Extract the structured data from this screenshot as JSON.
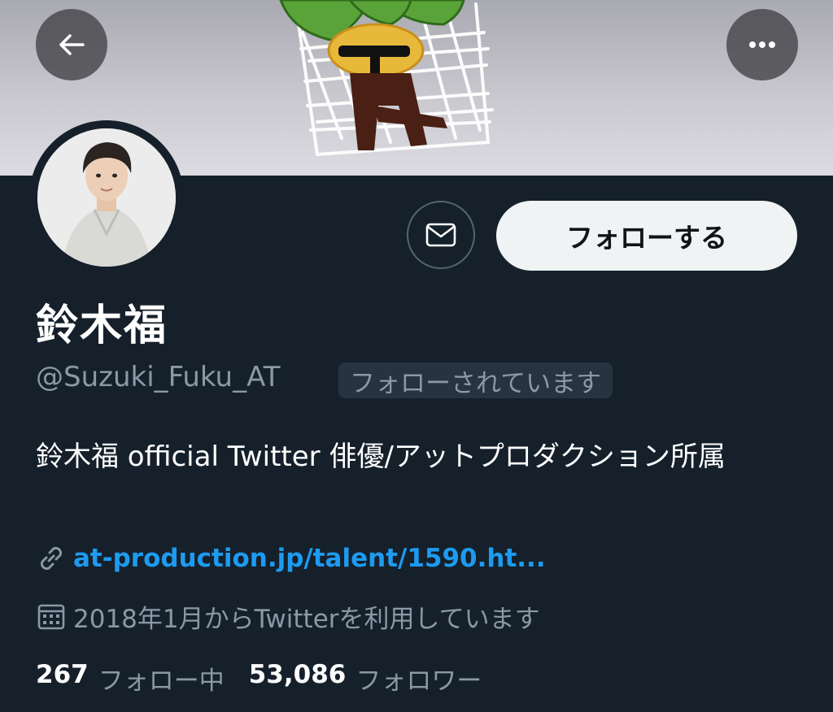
{
  "profile": {
    "display_name": "鈴木福",
    "handle": "@Suzuki_Fuku_AT",
    "follows_you_badge": "フォローされています",
    "bio": "鈴木福 official Twitter 俳優/アットプロダクション所属",
    "link": "at-production.jp/talent/1590.ht...",
    "joined": "2018年1月からTwitterを利用しています"
  },
  "actions": {
    "follow_label": "フォローする"
  },
  "stats": {
    "following_count": "267",
    "following_label": "フォロー中",
    "followers_count": "53,086",
    "followers_label": "フォロワー"
  },
  "icons": {
    "back": "arrow-left-icon",
    "more": "more-horizontal-icon",
    "message": "envelope-icon",
    "link": "link-icon",
    "calendar": "calendar-icon"
  },
  "colors": {
    "background": "#15202b",
    "secondary_text": "#8b98a5",
    "link": "#1d9bf0",
    "follow_button_bg": "#eff3f4"
  }
}
